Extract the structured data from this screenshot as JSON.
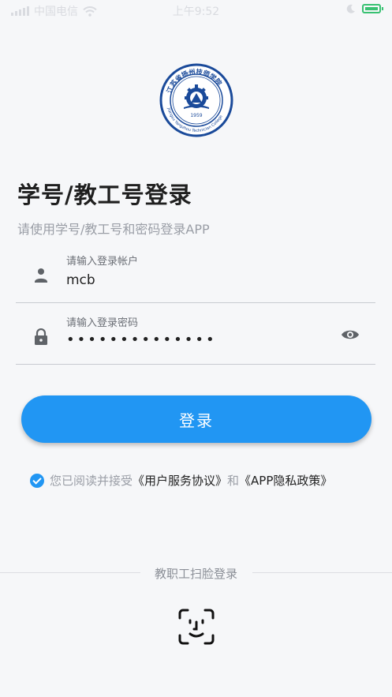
{
  "status_bar": {
    "carrier": "中国电信",
    "time": "上午9:52"
  },
  "logo": {
    "ring_text": "江苏省扬州技师学院",
    "en_text": "Jiangsu Yangzhou Technician College",
    "year": "1959"
  },
  "header": {
    "title": "学号/教工号登录",
    "subtitle": "请使用学号/教工号和密码登录APP"
  },
  "account_field": {
    "label": "请输入登录帐户",
    "value": "mcb",
    "icon": "person-icon"
  },
  "password_field": {
    "label": "请输入登录密码",
    "value": "••••••••••••••",
    "icon": "lock-icon",
    "toggle_icon": "eye-icon"
  },
  "login_button": {
    "label": "登录"
  },
  "agreement": {
    "checked": true,
    "prefix": "您已阅读并接受",
    "terms_link": "《用户服务协议》",
    "and": "和",
    "privacy_link": "《APP隐私政策》"
  },
  "face_login": {
    "label": "教职工扫脸登录",
    "icon": "face-scan-icon"
  },
  "colors": {
    "accent": "#2196f3",
    "background": "#f6f7f9",
    "logo_blue": "#1a4a9a"
  }
}
